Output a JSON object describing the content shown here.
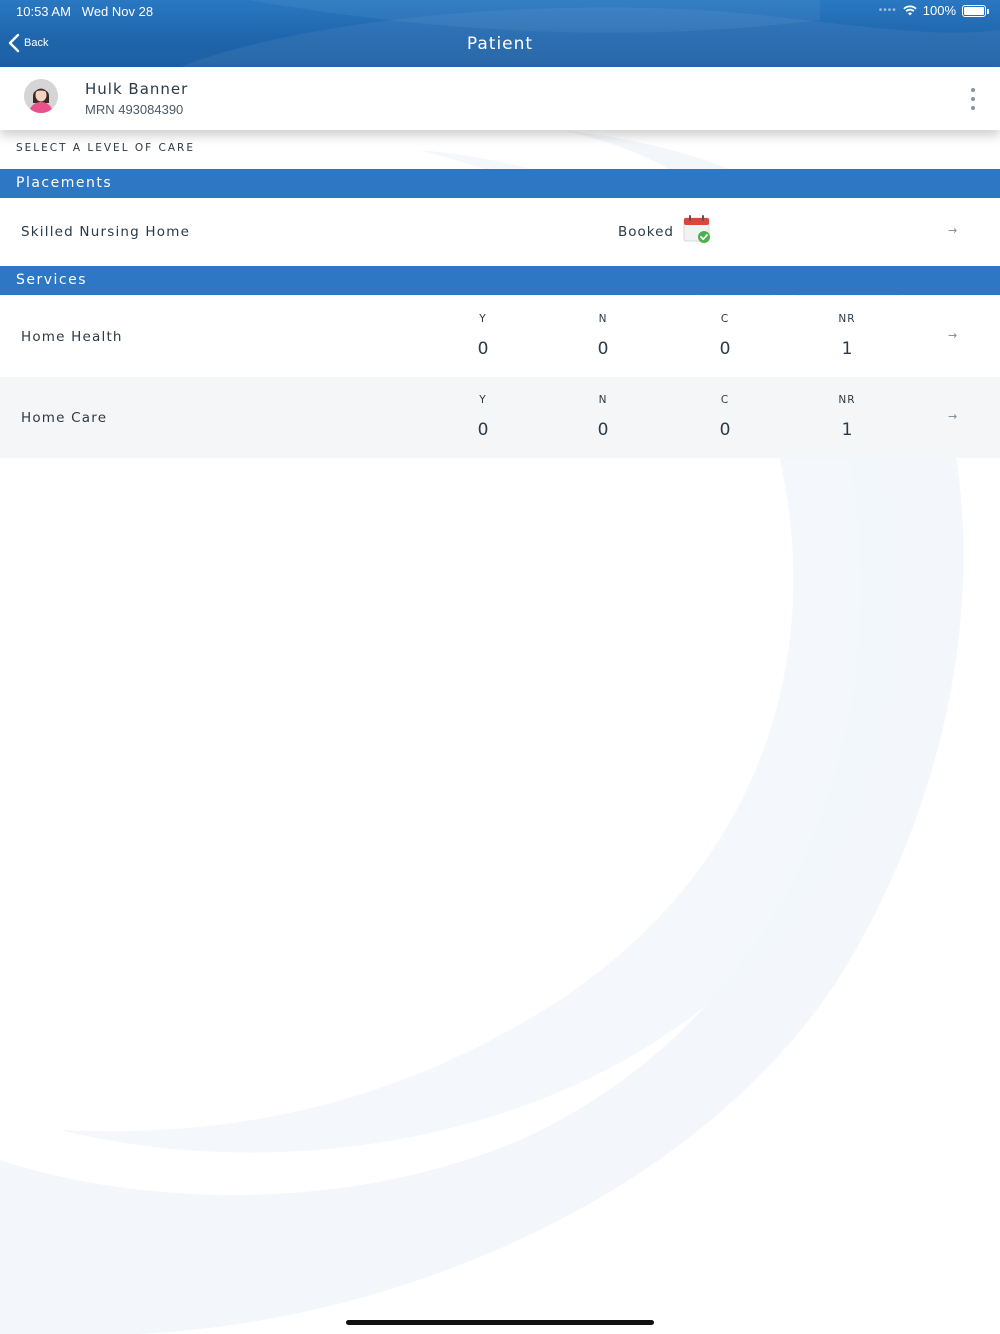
{
  "status_bar": {
    "time": "10:53 AM",
    "date": "Wed Nov 28",
    "battery": "100%"
  },
  "nav": {
    "back_label": "Back",
    "title": "Patient"
  },
  "patient": {
    "name": "Hulk Banner",
    "mrn": "MRN 493084390"
  },
  "caption": "SELECT A LEVEL OF CARE",
  "placements": {
    "header": "Placements",
    "items": [
      {
        "label": "Skilled Nursing Home",
        "status": "Booked",
        "icon": "calendar-check-icon"
      }
    ]
  },
  "services": {
    "header": "Services",
    "items": [
      {
        "label": "Home Health",
        "stats": [
          {
            "key": "Y",
            "value": "0"
          },
          {
            "key": "N",
            "value": "0"
          },
          {
            "key": "C",
            "value": "0"
          },
          {
            "key": "NR",
            "value": "1"
          }
        ]
      },
      {
        "label": "Home Care",
        "stats": [
          {
            "key": "Y",
            "value": "0"
          },
          {
            "key": "N",
            "value": "0"
          },
          {
            "key": "C",
            "value": "0"
          },
          {
            "key": "NR",
            "value": "1"
          }
        ]
      }
    ]
  },
  "colors": {
    "nav_blue": "#1f66ad",
    "section_blue": "#2d77c4",
    "alt_row": "#f5f6f7",
    "booked_green": "#4caf50",
    "calendar_red": "#d9463c"
  }
}
